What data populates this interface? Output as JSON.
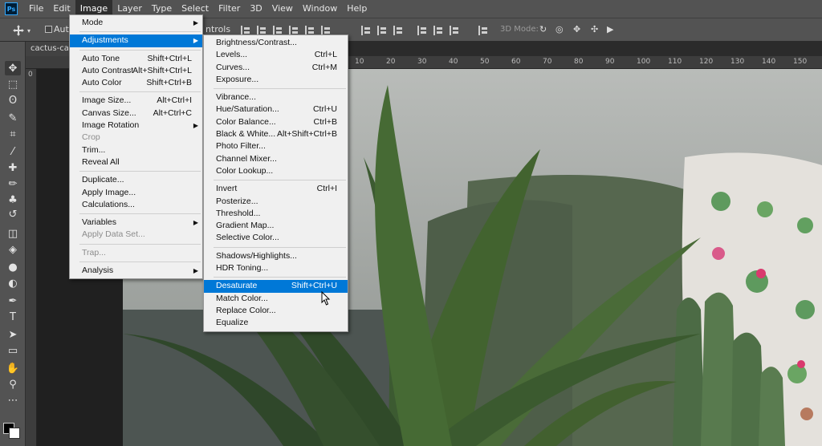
{
  "app": {
    "logo": "Ps"
  },
  "menubar": [
    "File",
    "Edit",
    "Image",
    "Layer",
    "Type",
    "Select",
    "Filter",
    "3D",
    "View",
    "Window",
    "Help"
  ],
  "options": {
    "auto_select": "Auto-",
    "controls": "ntrols",
    "mode_3d": "3D Mode:"
  },
  "document": {
    "tab_title": "cactus-cact"
  },
  "rulers": {
    "top": [
      "10",
      "20",
      "30",
      "40",
      "50",
      "60",
      "70",
      "80",
      "90",
      "100",
      "110",
      "120",
      "130",
      "140",
      "150"
    ],
    "left": [
      "0"
    ]
  },
  "image_menu": [
    {
      "label": "Mode",
      "submenu": true
    },
    {
      "sep": true
    },
    {
      "label": "Adjustments",
      "submenu": true,
      "highlight": true
    },
    {
      "sep": true
    },
    {
      "label": "Auto Tone",
      "shortcut": "Shift+Ctrl+L"
    },
    {
      "label": "Auto Contrast",
      "shortcut": "Alt+Shift+Ctrl+L"
    },
    {
      "label": "Auto Color",
      "shortcut": "Shift+Ctrl+B"
    },
    {
      "sep": true
    },
    {
      "label": "Image Size...",
      "shortcut": "Alt+Ctrl+I"
    },
    {
      "label": "Canvas Size...",
      "shortcut": "Alt+Ctrl+C"
    },
    {
      "label": "Image Rotation",
      "submenu": true
    },
    {
      "label": "Crop",
      "disabled": true
    },
    {
      "label": "Trim..."
    },
    {
      "label": "Reveal All"
    },
    {
      "sep": true
    },
    {
      "label": "Duplicate..."
    },
    {
      "label": "Apply Image..."
    },
    {
      "label": "Calculations..."
    },
    {
      "sep": true
    },
    {
      "label": "Variables",
      "submenu": true
    },
    {
      "label": "Apply Data Set...",
      "disabled": true
    },
    {
      "sep": true
    },
    {
      "label": "Trap...",
      "disabled": true
    },
    {
      "sep": true
    },
    {
      "label": "Analysis",
      "submenu": true
    }
  ],
  "adjustments_menu": [
    {
      "label": "Brightness/Contrast..."
    },
    {
      "label": "Levels...",
      "shortcut": "Ctrl+L"
    },
    {
      "label": "Curves...",
      "shortcut": "Ctrl+M"
    },
    {
      "label": "Exposure..."
    },
    {
      "sep": true
    },
    {
      "label": "Vibrance..."
    },
    {
      "label": "Hue/Saturation...",
      "shortcut": "Ctrl+U"
    },
    {
      "label": "Color Balance...",
      "shortcut": "Ctrl+B"
    },
    {
      "label": "Black & White...",
      "shortcut": "Alt+Shift+Ctrl+B"
    },
    {
      "label": "Photo Filter..."
    },
    {
      "label": "Channel Mixer..."
    },
    {
      "label": "Color Lookup..."
    },
    {
      "sep": true
    },
    {
      "label": "Invert",
      "shortcut": "Ctrl+I"
    },
    {
      "label": "Posterize..."
    },
    {
      "label": "Threshold..."
    },
    {
      "label": "Gradient Map..."
    },
    {
      "label": "Selective Color..."
    },
    {
      "sep": true
    },
    {
      "label": "Shadows/Highlights..."
    },
    {
      "label": "HDR Toning..."
    },
    {
      "sep": true
    },
    {
      "label": "Desaturate",
      "shortcut": "Shift+Ctrl+U",
      "highlight": true
    },
    {
      "label": "Match Color..."
    },
    {
      "label": "Replace Color..."
    },
    {
      "label": "Equalize"
    }
  ],
  "tools": [
    "move-tool-icon",
    "marquee-tool-icon",
    "lasso-tool-icon",
    "quick-select-tool-icon",
    "crop-tool-icon",
    "eyedropper-tool-icon",
    "healing-brush-icon",
    "brush-tool-icon",
    "clone-stamp-icon",
    "history-brush-icon",
    "eraser-tool-icon",
    "paint-bucket-icon",
    "blur-tool-icon",
    "dodge-tool-icon",
    "pen-tool-icon",
    "type-tool-icon",
    "path-select-icon",
    "rectangle-tool-icon",
    "hand-tool-icon",
    "zoom-tool-icon",
    "more-tools-icon"
  ],
  "tool_glyphs": [
    "✥",
    "⬚",
    "ʘ",
    "✎",
    "⌗",
    "⁄",
    "✚",
    "✏",
    "♣",
    "↺",
    "◫",
    "◈",
    "●",
    "◐",
    "✒",
    "T",
    "➤",
    "▭",
    "✋",
    "⚲",
    "⋯"
  ],
  "colors": {
    "highlight": "#0078d7",
    "menu_bg": "#f0f0f0",
    "chrome": "#535353"
  }
}
